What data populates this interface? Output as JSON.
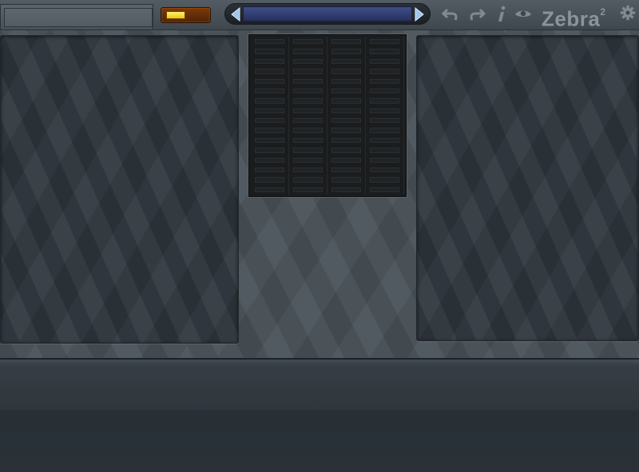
{
  "toolbar": {
    "preset_name": "",
    "browser_path": "",
    "logo_text": "Zebra",
    "logo_version": "2",
    "led_color": "#f3c400",
    "browser_color": "#2d3770"
  },
  "grid": {
    "columns": 4,
    "rows": 16
  },
  "icons": [
    "left-arrow-icon",
    "right-arrow-icon",
    "undo-icon",
    "redo-icon",
    "info-icon",
    "eye-icon",
    "gear-icon"
  ]
}
